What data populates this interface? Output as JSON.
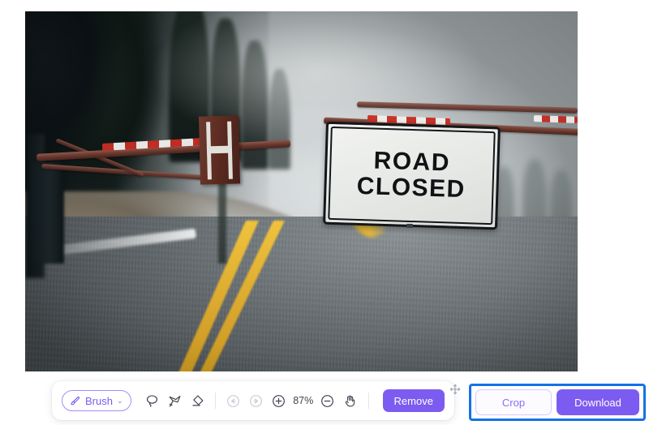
{
  "app": {
    "background_color": "#ffffff",
    "accent_color": "#7c5cf0",
    "highlight_color": "#1472e6"
  },
  "canvas": {
    "name": "image-editor-canvas",
    "photo_description": "Winter mountain road blocked by a red and white striped barrier gate with a ROAD CLOSED sign",
    "sign": {
      "line1": "ROAD",
      "line2": "CLOSED"
    }
  },
  "toolbar": {
    "brush": {
      "label": "Brush",
      "caret": "⌄",
      "icon": "brush-icon",
      "active": true
    },
    "tools": [
      {
        "name": "lasso-tool",
        "icon": "lasso-icon",
        "label": "Lasso",
        "disabled": false
      },
      {
        "name": "polygon-lasso-tool",
        "icon": "polygon-lasso-icon",
        "label": "Polygon Lasso",
        "disabled": false
      },
      {
        "name": "eraser-tool",
        "icon": "eraser-icon",
        "label": "Eraser",
        "disabled": false
      }
    ],
    "history": [
      {
        "name": "undo-button",
        "icon": "undo-icon",
        "label": "Undo",
        "disabled": true
      },
      {
        "name": "redo-button",
        "icon": "redo-icon",
        "label": "Redo",
        "disabled": true
      }
    ],
    "zoom": {
      "zoom_in_icon": "zoom-in-icon",
      "zoom_out_icon": "zoom-out-icon",
      "level": "87%"
    },
    "pan": {
      "name": "pan-tool",
      "icon": "hand-icon",
      "label": "Pan"
    },
    "remove_label": "Remove",
    "drag_handle_icon": "move-icon"
  },
  "actions": {
    "crop_label": "Crop",
    "download_label": "Download",
    "highlighted": true
  }
}
